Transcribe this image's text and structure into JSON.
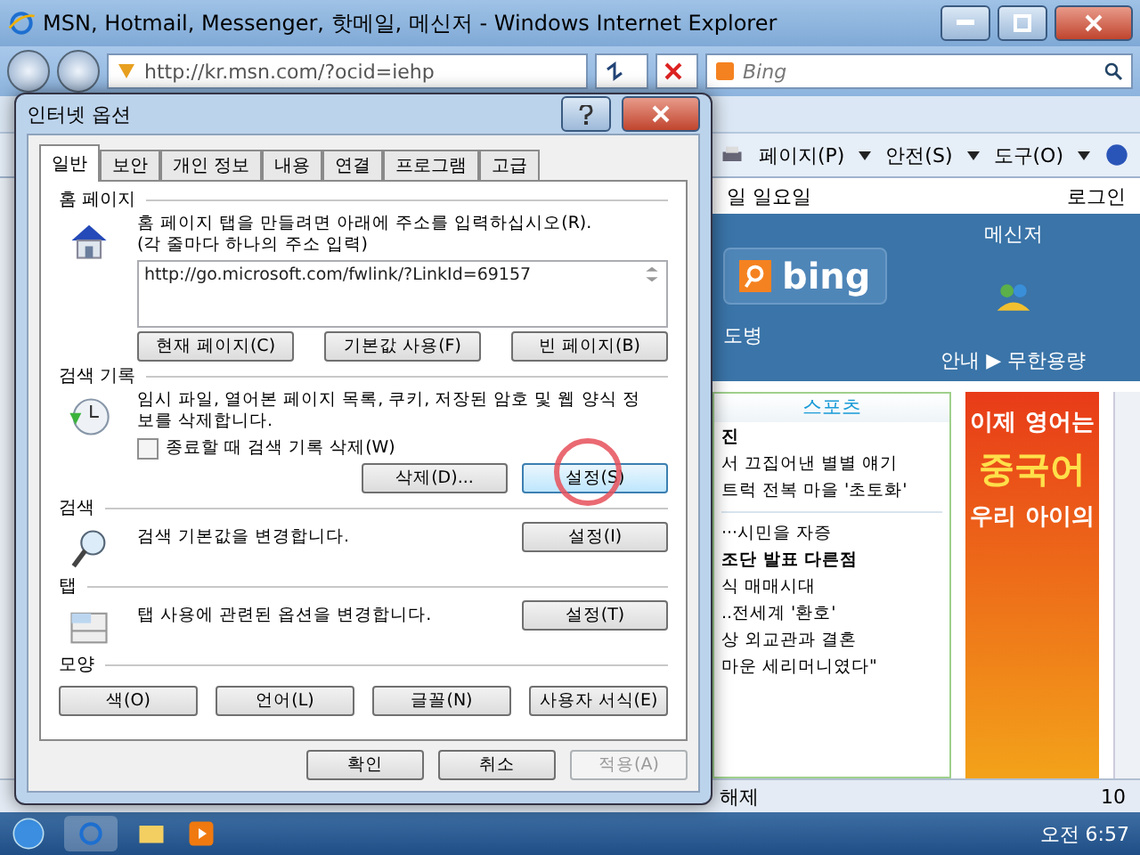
{
  "browser": {
    "title": "MSN, Hotmail, Messenger, 핫메일, 메신저 - Windows Internet Explorer",
    "address": "http://kr.msn.com/?ocid=iehp",
    "search_placeholder": "Bing",
    "toolbar": [
      "페이지(P)",
      "안전(S)",
      "도구(O)"
    ]
  },
  "page": {
    "date": "일 일요일",
    "login": "로그인",
    "bing": "bing",
    "messenger": "메신저",
    "sub_left": "도병",
    "sub_right": "안내 ▶ 무한용량",
    "news_tab": "스포츠",
    "news_top": [
      "진",
      "서 끄집어낸 별별 얘기",
      "트럭 전복 마을 '초토화'"
    ],
    "news_list": [
      {
        "text": "···시민을 자증",
        "bold": false
      },
      {
        "text": "조단 발표 다른점",
        "bold": true
      },
      {
        "text": "식 매매시대",
        "bold": false
      },
      {
        "text": "..전세계 '환호'",
        "bold": false
      },
      {
        "text": "상 외교관과 결혼",
        "bold": false
      },
      {
        "text": "마운 세리머니였다\"",
        "bold": false
      }
    ],
    "ad_lines": [
      "이제 영어는",
      "중국어",
      "우리 아이의"
    ],
    "status": "해제",
    "zoom": "10"
  },
  "dialog": {
    "title": "인터넷 옵션",
    "tabs": [
      {
        "label": "일반",
        "selected": true
      },
      {
        "label": "보안",
        "selected": false
      },
      {
        "label": "개인 정보",
        "selected": false
      },
      {
        "label": "내용",
        "selected": false
      },
      {
        "label": "연결",
        "selected": false
      },
      {
        "label": "프로그램",
        "selected": false
      },
      {
        "label": "고급",
        "selected": false
      }
    ],
    "sections": [
      {
        "kind": "home",
        "heading": "홈 페이지",
        "lines": [
          "홈 페이지 탭을 만들려면 아래에 주소를 입력하십시오(R).",
          "(각 줄마다 하나의 주소 입력)"
        ],
        "url": "http://go.microsoft.com/fwlink/?LinkId=69157",
        "buttons": [
          {
            "label": "현재 페이지(C)",
            "focused": false,
            "circled": false
          },
          {
            "label": "기본값 사용(F)",
            "focused": false,
            "circled": false
          },
          {
            "label": "빈 페이지(B)",
            "focused": false,
            "circled": false
          }
        ]
      },
      {
        "kind": "history",
        "heading": "검색 기록",
        "lines": [
          "임시 파일, 열어본 페이지 목록, 쿠키, 저장된 암호 및 웹 양식 정",
          "보를 삭제합니다."
        ],
        "checkbox": {
          "label": "종료할 때 검색 기록 삭제(W)",
          "checked": false
        },
        "buttons": [
          {
            "label": "삭제(D)...",
            "focused": false,
            "circled": false
          },
          {
            "label": "설정(S)",
            "focused": true,
            "circled": true
          }
        ]
      },
      {
        "kind": "search",
        "heading": "검색",
        "lines": [
          "검색 기본값을 변경합니다."
        ],
        "buttons": [
          {
            "label": "설정(I)",
            "focused": false,
            "circled": false
          }
        ]
      },
      {
        "kind": "tabs",
        "heading": "탭",
        "lines": [
          "탭 사용에 관련된 옵션을 변경합니다."
        ],
        "buttons": [
          {
            "label": "설정(T)",
            "focused": false,
            "circled": false
          }
        ]
      },
      {
        "kind": "appearance",
        "heading": "모양",
        "buttons": [
          {
            "label": "색(O)",
            "focused": false,
            "circled": false
          },
          {
            "label": "언어(L)",
            "focused": false,
            "circled": false
          },
          {
            "label": "글꼴(N)",
            "focused": false,
            "circled": false
          },
          {
            "label": "사용자 서식(E)",
            "focused": false,
            "circled": false
          }
        ]
      }
    ],
    "buttons": [
      {
        "label": "확인",
        "disabled": false
      },
      {
        "label": "취소",
        "disabled": false
      },
      {
        "label": "적용(A)",
        "disabled": true
      }
    ]
  },
  "taskbar": {
    "time": "오전 6:57"
  }
}
